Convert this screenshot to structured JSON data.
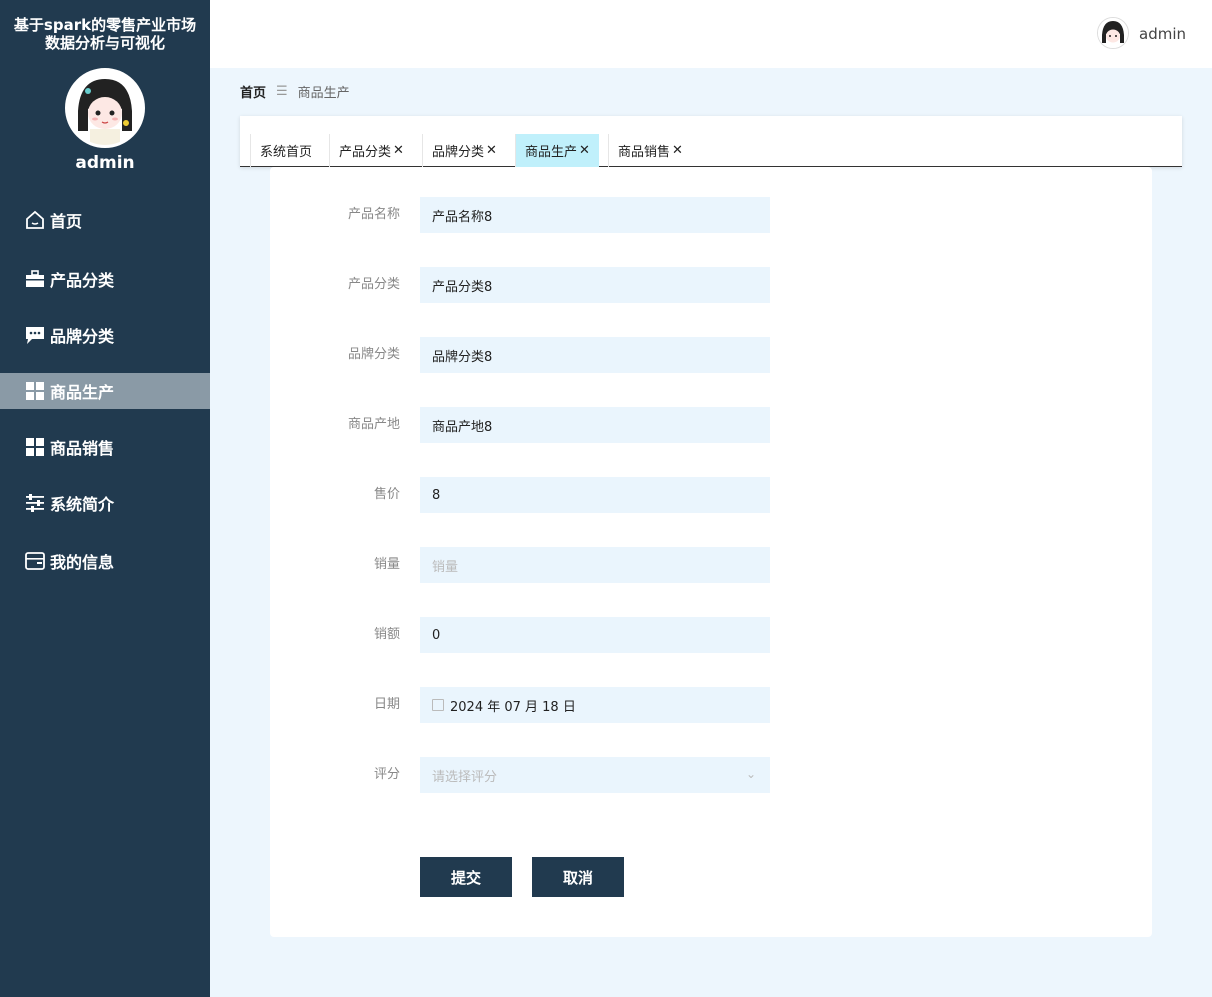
{
  "app": {
    "title": "基于spark的零售产业市场数据分析与可视化"
  },
  "sidebar": {
    "user": "admin",
    "items": [
      {
        "label": "首页",
        "icon": "home-icon",
        "active": false
      },
      {
        "label": "产品分类",
        "icon": "briefcase-icon",
        "active": false
      },
      {
        "label": "品牌分类",
        "icon": "chat-bubble-icon",
        "active": false
      },
      {
        "label": "商品生产",
        "icon": "grid-icon",
        "active": true
      },
      {
        "label": "商品销售",
        "icon": "grid-icon",
        "active": false
      },
      {
        "label": "系统简介",
        "icon": "sliders-icon",
        "active": false
      },
      {
        "label": "我的信息",
        "icon": "wallet-icon",
        "active": false
      }
    ]
  },
  "header": {
    "user": "admin"
  },
  "breadcrumb": {
    "home": "首页",
    "separator": "☰",
    "current": "商品生产"
  },
  "tabs": [
    {
      "label": "系统首页",
      "closable": false,
      "active": false
    },
    {
      "label": "产品分类",
      "closable": true,
      "active": false
    },
    {
      "label": "品牌分类",
      "closable": true,
      "active": false
    },
    {
      "label": "商品生产",
      "closable": true,
      "active": true
    },
    {
      "label": "商品销售",
      "closable": true,
      "active": false
    }
  ],
  "form": {
    "fields": [
      {
        "label": "产品名称",
        "value": "产品名称8",
        "placeholder": ""
      },
      {
        "label": "产品分类",
        "value": "产品分类8",
        "placeholder": ""
      },
      {
        "label": "品牌分类",
        "value": "品牌分类8",
        "placeholder": ""
      },
      {
        "label": "商品产地",
        "value": "商品产地8",
        "placeholder": ""
      },
      {
        "label": "售价",
        "value": "8",
        "placeholder": ""
      },
      {
        "label": "销量",
        "value": "",
        "placeholder": "销量"
      },
      {
        "label": "销额",
        "value": "0",
        "placeholder": ""
      },
      {
        "label": "日期",
        "value": "2024 年 07 月 18 日",
        "placeholder": ""
      },
      {
        "label": "评分",
        "value": "",
        "placeholder": "请选择评分"
      }
    ],
    "submit_label": "提交",
    "cancel_label": "取消"
  },
  "colors": {
    "sidebar_bg": "#213a4f",
    "active_menu": "#8a9aa6",
    "active_tab": "#c0f0fb",
    "input_bg": "#eaf5fd",
    "page_bg": "#edf6fd"
  }
}
